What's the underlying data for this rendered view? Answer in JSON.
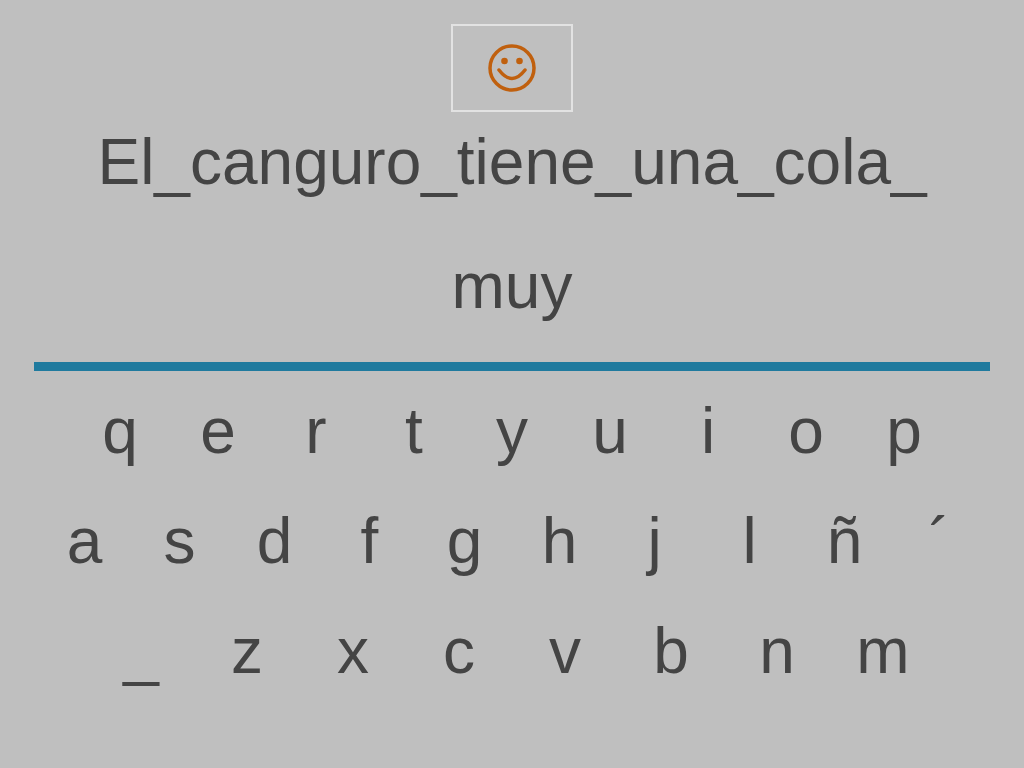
{
  "prompt": {
    "lines": [
      "El_canguro_tiene_una_cola_",
      "muy"
    ]
  },
  "keyboard": {
    "rows": [
      [
        "q",
        "e",
        "r",
        "t",
        "y",
        "u",
        "i",
        "o",
        "p"
      ],
      [
        "a",
        "s",
        "d",
        "f",
        "g",
        "h",
        "j",
        "l",
        "ñ",
        "´"
      ],
      [
        "_",
        "z",
        "x",
        "c",
        "v",
        "b",
        "n",
        "m"
      ]
    ]
  }
}
